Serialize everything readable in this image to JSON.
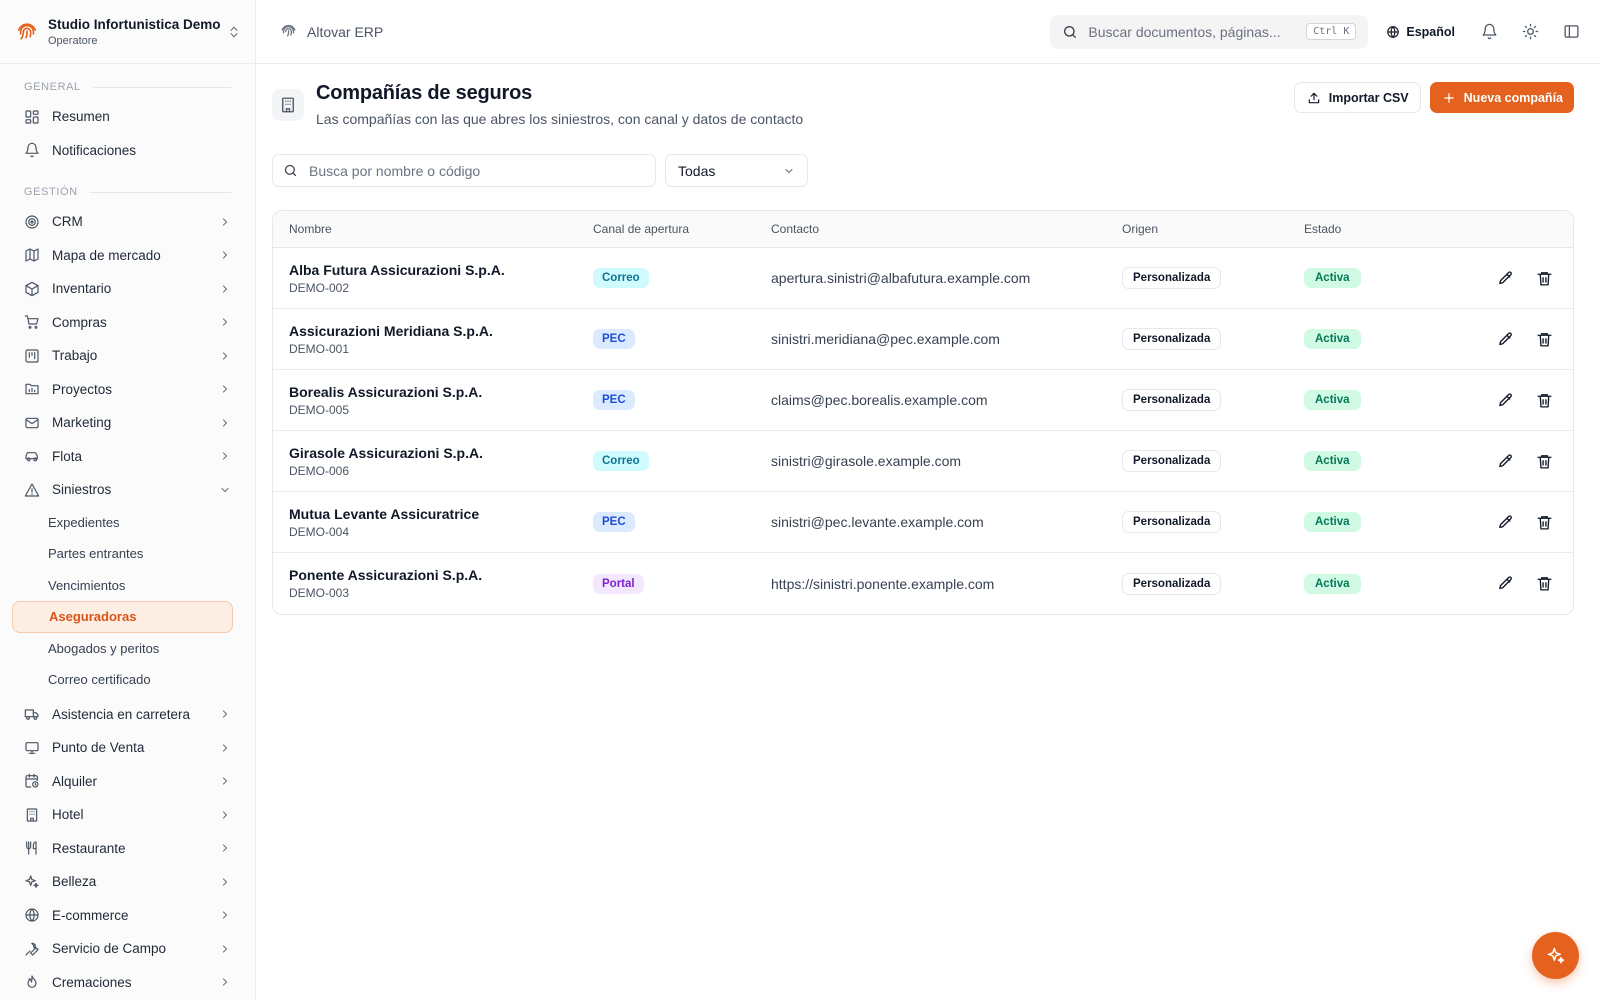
{
  "workspace": {
    "name": "Studio Infortunistica Demo",
    "role": "Operatore"
  },
  "topbar": {
    "brand": "Altovar ERP",
    "search_placeholder": "Buscar documentos, páginas...",
    "shortcut": "Ctrl K",
    "language": "Español"
  },
  "sidebar": {
    "section_general": "GENERAL",
    "section_gestion": "GESTIÓN",
    "general_items": [
      {
        "label": "Resumen",
        "icon": "dashboard-icon"
      },
      {
        "label": "Notificaciones",
        "icon": "bell-icon"
      }
    ],
    "items": [
      {
        "label": "CRM",
        "icon": "target-icon"
      },
      {
        "label": "Mapa de mercado",
        "icon": "map-icon"
      },
      {
        "label": "Inventario",
        "icon": "box-icon"
      },
      {
        "label": "Compras",
        "icon": "cart-icon"
      },
      {
        "label": "Trabajo",
        "icon": "kanban-icon"
      },
      {
        "label": "Proyectos",
        "icon": "folder-chart-icon"
      },
      {
        "label": "Marketing",
        "icon": "mail-icon"
      },
      {
        "label": "Flota",
        "icon": "car-icon"
      },
      {
        "label": "Siniestros",
        "icon": "warning-icon"
      }
    ],
    "siniestros_sub": [
      {
        "label": "Expedientes"
      },
      {
        "label": "Partes entrantes"
      },
      {
        "label": "Vencimientos"
      },
      {
        "label": "Aseguradoras"
      },
      {
        "label": "Abogados y peritos"
      },
      {
        "label": "Correo certificado"
      }
    ],
    "items_after": [
      {
        "label": "Asistencia en carretera",
        "icon": "truck-icon"
      },
      {
        "label": "Punto de Venta",
        "icon": "monitor-icon"
      },
      {
        "label": "Alquiler",
        "icon": "calendar-clock-icon"
      },
      {
        "label": "Hotel",
        "icon": "building-icon"
      },
      {
        "label": "Restaurante",
        "icon": "utensils-icon"
      },
      {
        "label": "Belleza",
        "icon": "sparkles-icon"
      },
      {
        "label": "E-commerce",
        "icon": "globe-icon"
      },
      {
        "label": "Servicio de Campo",
        "icon": "wrench-icon"
      },
      {
        "label": "Cremaciones",
        "icon": "flame-icon"
      }
    ]
  },
  "page": {
    "title": "Compañías de seguros",
    "subtitle": "Las compañías con las que abres los siniestros, con canal y datos de contacto",
    "import_label": "Importar CSV",
    "new_label": "Nueva compañía",
    "search_placeholder": "Busca por nombre o código",
    "filter_value": "Todas"
  },
  "table": {
    "headers": [
      "Nombre",
      "Canal de apertura",
      "Contacto",
      "Origen",
      "Estado"
    ],
    "rows": [
      {
        "name": "Alba Futura Assicurazioni S.p.A.",
        "code": "DEMO-002",
        "channel": "Correo",
        "contact": "apertura.sinistri@albafutura.example.com",
        "origin": "Personalizada",
        "status": "Activa"
      },
      {
        "name": "Assicurazioni Meridiana S.p.A.",
        "code": "DEMO-001",
        "channel": "PEC",
        "contact": "sinistri.meridiana@pec.example.com",
        "origin": "Personalizada",
        "status": "Activa"
      },
      {
        "name": "Borealis Assicurazioni S.p.A.",
        "code": "DEMO-005",
        "channel": "PEC",
        "contact": "claims@pec.borealis.example.com",
        "origin": "Personalizada",
        "status": "Activa"
      },
      {
        "name": "Girasole Assicurazioni S.p.A.",
        "code": "DEMO-006",
        "channel": "Correo",
        "contact": "sinistri@girasole.example.com",
        "origin": "Personalizada",
        "status": "Activa"
      },
      {
        "name": "Mutua Levante Assicuratrice",
        "code": "DEMO-004",
        "channel": "PEC",
        "contact": "sinistri@pec.levante.example.com",
        "origin": "Personalizada",
        "status": "Activa"
      },
      {
        "name": "Ponente Assicurazioni S.p.A.",
        "code": "DEMO-003",
        "channel": "Portal",
        "contact": "https://sinistri.ponente.example.com",
        "origin": "Personalizada",
        "status": "Activa"
      }
    ]
  },
  "colors": {
    "accent": "#e4611e",
    "channel_Correo": [
      "#cffafe",
      "#0e7490"
    ],
    "channel_PEC": [
      "#dbeafe",
      "#1d4ed8"
    ],
    "channel_Portal": [
      "#f3e8ff",
      "#7e22ce"
    ]
  }
}
